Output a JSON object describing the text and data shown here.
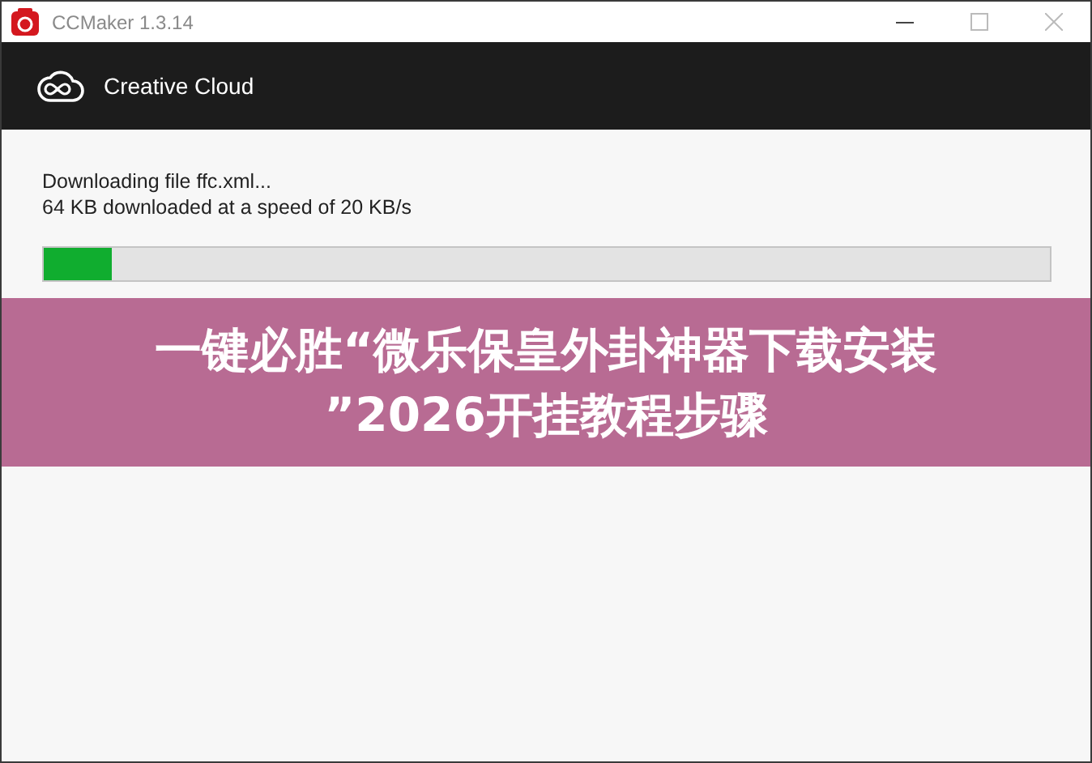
{
  "window": {
    "title": "CCMaker 1.3.14"
  },
  "header": {
    "title": "Creative Cloud"
  },
  "download": {
    "status": "Downloading file ffc.xml...",
    "detail": "64 KB downloaded at a speed of 20 KB/s",
    "level": 0.068
  },
  "banner": {
    "lines": [
      "一键必胜“微乐保皇外卦神器下载安装",
      "”2026开挂教程步骤"
    ]
  }
}
